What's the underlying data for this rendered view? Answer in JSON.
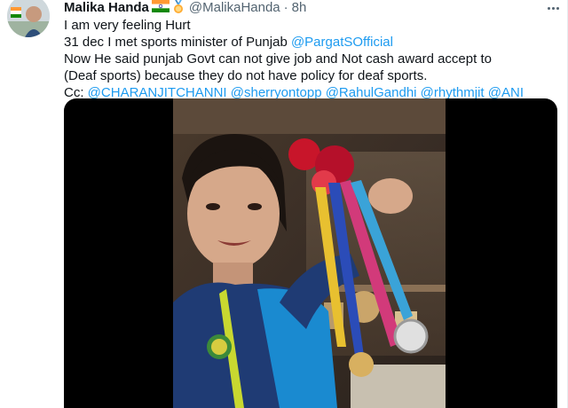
{
  "tweet": {
    "author_name": "Malika Handa",
    "author_handle": "@MalikaHanda",
    "separator": "·",
    "timestamp": "8h",
    "flag_icon": "india-flag-icon",
    "medal_icon": "medal-icon",
    "more_icon": "more-options-icon",
    "lines": [
      {
        "parts": [
          {
            "text": "I am very feeling Hurt",
            "link": false
          }
        ]
      },
      {
        "parts": [
          {
            "text": "31 dec I met sports minister of Punjab ",
            "link": false
          },
          {
            "text": "@PargatSOfficial",
            "link": true
          }
        ]
      },
      {
        "parts": [
          {
            "text": " Now He said punjab Govt can not give job and Not cash award accept to",
            "link": false
          }
        ]
      },
      {
        "parts": [
          {
            "text": "(Deaf sports) because they do not have policy for deaf sports.",
            "link": false
          }
        ]
      },
      {
        "parts": [
          {
            "text": "Cc: ",
            "link": false
          },
          {
            "text": "@CHARANJITCHANNI",
            "link": true
          },
          {
            "text": " ",
            "link": false
          },
          {
            "text": "@sherryontopp",
            "link": true
          },
          {
            "text": " ",
            "link": false
          },
          {
            "text": "@RahulGandhi",
            "link": true
          },
          {
            "text": " ",
            "link": false
          },
          {
            "text": "@rhythmjit",
            "link": true
          },
          {
            "text": " ",
            "link": false
          },
          {
            "text": "@ANI",
            "link": true
          }
        ]
      }
    ]
  },
  "colors": {
    "link": "#1d9bf0",
    "text": "#0f1419",
    "secondary": "#536471",
    "media_bg": "#000000"
  }
}
